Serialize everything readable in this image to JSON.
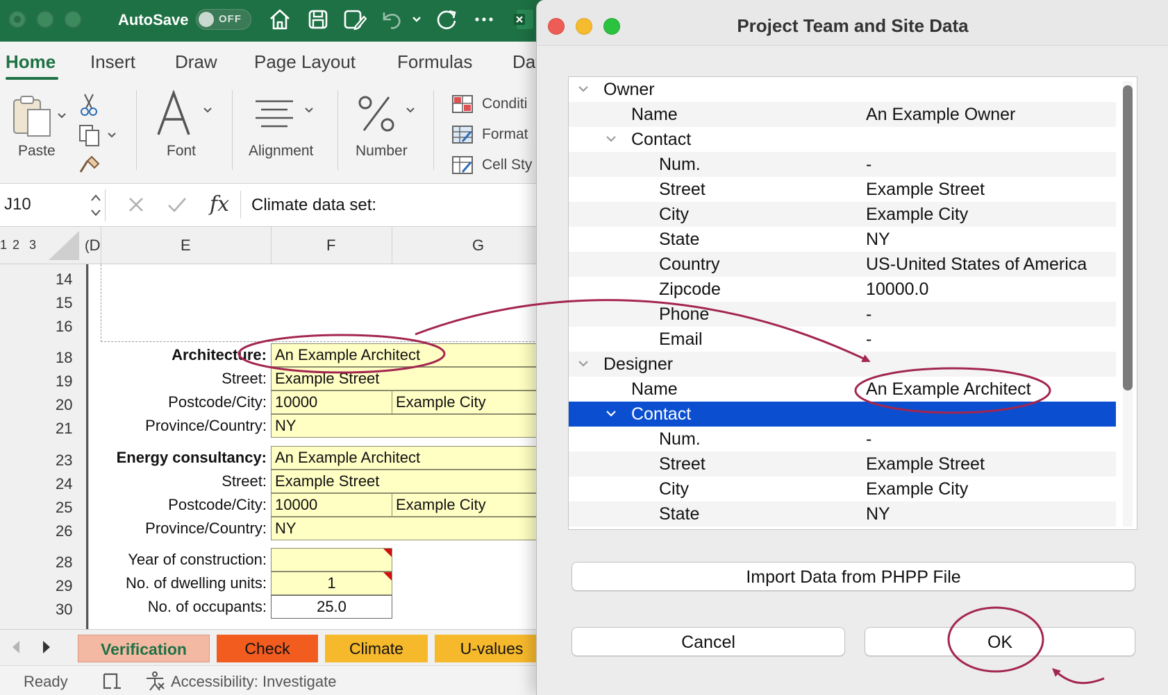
{
  "excel": {
    "autosave_label": "AutoSave",
    "autosave_state": "OFF",
    "ribbon_tabs": [
      "Home",
      "Insert",
      "Draw",
      "Page Layout",
      "Formulas",
      "Dat"
    ],
    "groups": {
      "paste": "Paste",
      "font": "Font",
      "alignment": "Alignment",
      "number": "Number",
      "conditional": "Conditi",
      "format": "Format",
      "cell_styles": "Cell Sty"
    },
    "name_box": "J10",
    "formula": "Climate data set:",
    "columns": [
      "D",
      "E",
      "F",
      "G"
    ],
    "outline_levels": [
      "1",
      "2",
      "3"
    ],
    "row_numbers": [
      "14",
      "15",
      "16",
      "18",
      "19",
      "20",
      "21",
      "23",
      "24",
      "25",
      "26",
      "28",
      "29",
      "30"
    ],
    "architecture": {
      "label": "Architecture:",
      "name": "An Example Architect",
      "street_label": "Street:",
      "street": "Example Street",
      "postcode_label": "Postcode/City:",
      "postcode": "10000",
      "city": "Example City",
      "province_label": "Province/Country:",
      "province": "NY"
    },
    "energy": {
      "label": "Energy consultancy:",
      "name": "An Example Architect",
      "street_label": "Street:",
      "street": "Example Street",
      "postcode_label": "Postcode/City:",
      "postcode": "10000",
      "city": "Example City",
      "province_label": "Province/Country:",
      "province": "NY"
    },
    "building": {
      "year_label": "Year of construction:",
      "year": "",
      "units_label": "No. of dwelling units:",
      "units": "1",
      "occupants_label": "No. of occupants:",
      "occupants": "25.0"
    },
    "sheet_tabs": [
      {
        "label": "Verification",
        "color": "#f4b9a3",
        "text": "#1e7145"
      },
      {
        "label": "Check",
        "color": "#f25c1f",
        "text": "#111111"
      },
      {
        "label": "Climate",
        "color": "#f7b92c",
        "text": "#111111"
      },
      {
        "label": "U-values",
        "color": "#f7b92c",
        "text": "#111111"
      }
    ],
    "status": "Ready",
    "accessibility": "Accessibility: Investigate"
  },
  "dialog": {
    "title": "Project Team and Site Data",
    "tree": [
      {
        "key": "Owner",
        "value": "",
        "level": 0,
        "chevron": true
      },
      {
        "key": "Name",
        "value": "An Example Owner",
        "level": 1
      },
      {
        "key": "Contact",
        "value": "",
        "level": 1,
        "chevron": true
      },
      {
        "key": "Num.",
        "value": "-",
        "level": 2
      },
      {
        "key": "Street",
        "value": "Example Street",
        "level": 2
      },
      {
        "key": "City",
        "value": "Example City",
        "level": 2
      },
      {
        "key": "State",
        "value": "NY",
        "level": 2
      },
      {
        "key": "Country",
        "value": "US-United States of America",
        "level": 2
      },
      {
        "key": "Zipcode",
        "value": "10000.0",
        "level": 2
      },
      {
        "key": "Phone",
        "value": "-",
        "level": 2
      },
      {
        "key": "Email",
        "value": "-",
        "level": 2
      },
      {
        "key": "Designer",
        "value": "",
        "level": 0,
        "chevron": true
      },
      {
        "key": "Name",
        "value": "An Example Architect",
        "level": 1
      },
      {
        "key": "Contact",
        "value": "",
        "level": 1,
        "chevron": true,
        "selected": true
      },
      {
        "key": "Num.",
        "value": "-",
        "level": 2
      },
      {
        "key": "Street",
        "value": "Example Street",
        "level": 2
      },
      {
        "key": "City",
        "value": "Example City",
        "level": 2
      },
      {
        "key": "State",
        "value": "NY",
        "level": 2
      }
    ],
    "import_button": "Import Data from PHPP File",
    "cancel_button": "Cancel",
    "ok_button": "OK"
  },
  "colors": {
    "excel_green": "#1e7145",
    "selection_blue": "#0b4fd0",
    "annotation": "#a3264f",
    "input_yellow": "#ffffc4"
  }
}
